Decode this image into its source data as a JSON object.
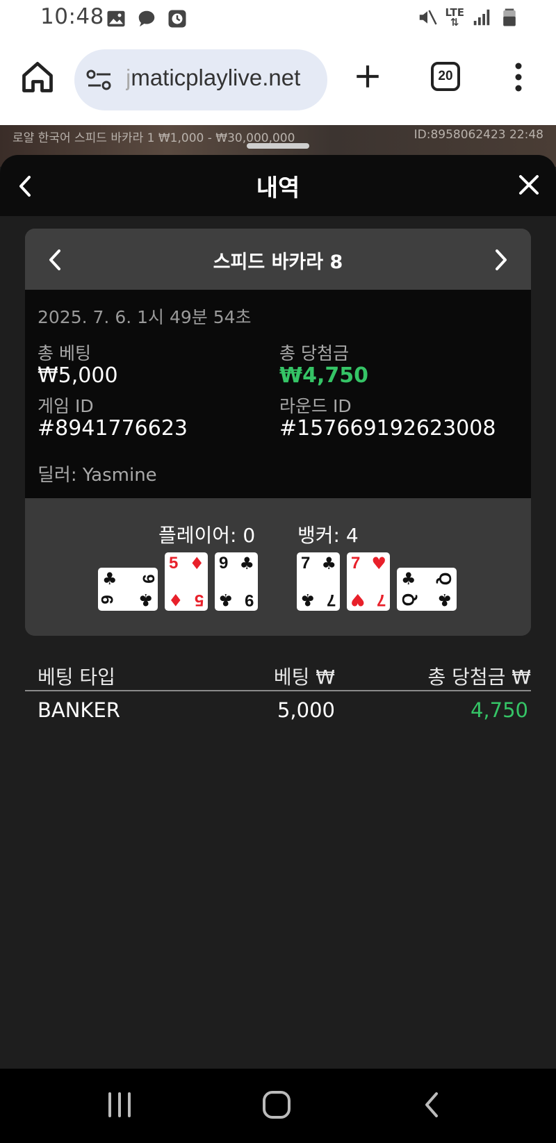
{
  "status_bar": {
    "time": "10:48",
    "network": "LTE",
    "icons_left": [
      "gallery-icon",
      "chat-bubble-icon",
      "clock-icon"
    ],
    "icons_right": [
      "mute-icon",
      "lte-icon",
      "signal-icon",
      "battery-icon"
    ]
  },
  "browser": {
    "url_faded": "j",
    "url_text": "maticplaylive.net",
    "tab_count": "20"
  },
  "game_strip": {
    "left_text": "로얄 한국어 스피드 바카라 1  ₩1,000 - ₩30,000,000",
    "right_text": "ID:8958062423  22:48"
  },
  "sheet": {
    "title": "내역"
  },
  "round": {
    "title": "스피드 바카라 8",
    "datetime": "2025. 7. 6. 1시 49분 54초",
    "total_bet_label": "총 베팅",
    "total_bet_value": "₩5,000",
    "total_win_label": "총 당첨금",
    "total_win_value": "₩4,750",
    "game_id_label": "게임 ID",
    "game_id_value": "#8941776623",
    "round_id_label": "라운드 ID",
    "round_id_value": "#157669192623008",
    "dealer": "딜러: Yasmine",
    "player_score": "플레이어: 0",
    "banker_score": "뱅커: 4",
    "player_cards": [
      {
        "rank": "9",
        "suit": "♣",
        "color": "#111111",
        "sideways": true
      },
      {
        "rank": "5",
        "suit": "♦",
        "color": "#e8202a",
        "sideways": false
      },
      {
        "rank": "9",
        "suit": "♣",
        "color": "#111111",
        "sideways": false
      }
    ],
    "banker_cards": [
      {
        "rank": "7",
        "suit": "♣",
        "color": "#111111",
        "sideways": false
      },
      {
        "rank": "7",
        "suit": "♥",
        "color": "#e8202a",
        "sideways": false
      },
      {
        "rank": "Q",
        "suit": "♣",
        "color": "#111111",
        "sideways": true
      }
    ]
  },
  "bets_table": {
    "headers": [
      "베팅 타입",
      "베팅 ₩",
      "총 당첨금 ₩"
    ],
    "rows": [
      {
        "type": "BANKER",
        "bet": "5,000",
        "win": "4,750"
      }
    ]
  },
  "colors": {
    "win_green": "#35c466",
    "sheet_bg": "#1e1e1e",
    "card_red": "#e8202a"
  }
}
